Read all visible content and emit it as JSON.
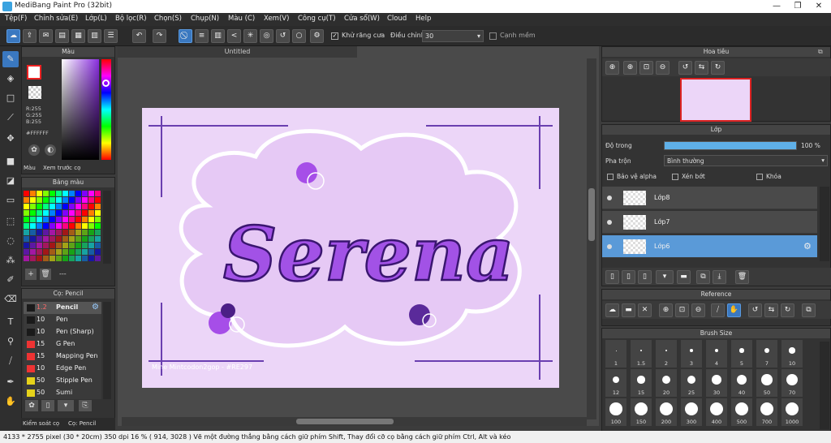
{
  "window": {
    "title": "MediBang Paint Pro (32bit)"
  },
  "menu": [
    "Tệp(F)",
    "Chỉnh sửa(E)",
    "Lớp(L)",
    "Bộ lọc(R)",
    "Chọn(S)",
    "Chụp(N)",
    "Màu (C)",
    "Xem(V)",
    "Công cụ(T)",
    "Cửa sổ(W)",
    "Cloud",
    "Help"
  ],
  "toolbar": {
    "antialias_label": "Khử răng cưa",
    "adjust_label": "Điều chỉnh",
    "adjust_value": "30",
    "edge_label": "Cạnh mềm"
  },
  "color_panel": {
    "title": "Màu",
    "r": "R:255",
    "g": "G:255",
    "b": "B:255",
    "hex": "#FFFFFF",
    "tab_color": "Màu",
    "tab_preview": "Xem trước cọ"
  },
  "swatch_panel": {
    "title": "Bảng màu",
    "dash": "---"
  },
  "brush_panel": {
    "title": "Cọ: Pencil",
    "items": [
      {
        "size": "1.2",
        "name": "Pencil",
        "color": "#1a1a1a"
      },
      {
        "size": "10",
        "name": "Pen",
        "color": "#1a1a1a"
      },
      {
        "size": "10",
        "name": "Pen (Sharp)",
        "color": "#1a1a1a"
      },
      {
        "size": "15",
        "name": "G Pen",
        "color": "#e33"
      },
      {
        "size": "15",
        "name": "Mapping Pen",
        "color": "#e33"
      },
      {
        "size": "10",
        "name": "Edge Pen",
        "color": "#e33"
      },
      {
        "size": "50",
        "name": "Stipple Pen",
        "color": "#e6d21a"
      },
      {
        "size": "50",
        "name": "Sumi",
        "color": "#e6d21a"
      }
    ],
    "tab_control": "Kiểm soát cọ",
    "tab_brush": "Cọ: Pencil"
  },
  "document": {
    "tab": "Untitled",
    "artwork_text": "Serena",
    "signature": "Mine Mintcodon2gop - #RE297"
  },
  "navigator": {
    "title": "Hoa tiêu"
  },
  "layer_panel": {
    "title": "Lớp",
    "opacity_label": "Độ trong",
    "opacity_value": "100 %",
    "opacity_fraction": 1.0,
    "blend_label": "Pha trộn",
    "blend_value": "Bình thường",
    "protect_alpha": "Bảo vệ alpha",
    "clipping": "Xén bớt",
    "lock": "Khóa",
    "layers": [
      {
        "name": "Lớp8"
      },
      {
        "name": "Lớp7"
      },
      {
        "name": "Lớp6"
      }
    ]
  },
  "reference": {
    "title": "Reference"
  },
  "brush_size": {
    "title": "Brush Size",
    "sizes": [
      "1",
      "1.5",
      "2",
      "3",
      "4",
      "5",
      "7",
      "10",
      "12",
      "15",
      "20",
      "25",
      "30",
      "40",
      "50",
      "70",
      "100",
      "150",
      "200",
      "300",
      "400",
      "500",
      "700",
      "1000"
    ]
  },
  "status": {
    "text": "4133 * 2755 pixel  (30 * 20cm)  350 dpi  16 %  ( 914, 3028 )  Vẽ một đường thẳng bằng cách giữ phím Shift, Thay đổi cỡ cọ bằng cách giữ phím Ctrl, Alt và kéo"
  }
}
